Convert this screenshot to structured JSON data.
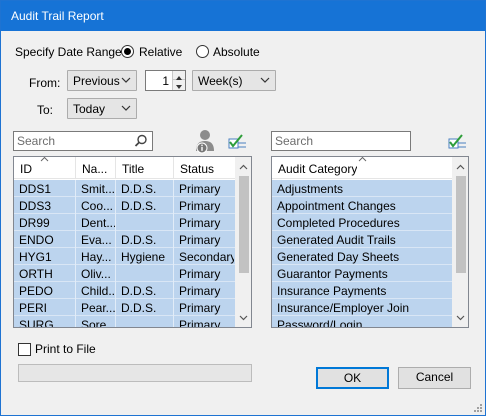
{
  "window": {
    "title": "Audit Trail Report"
  },
  "date_range": {
    "label": "Specify Date Range",
    "mode_options": [
      "Relative",
      "Absolute"
    ],
    "selected_mode": "Relative"
  },
  "from": {
    "label": "From:",
    "direction": "Previous",
    "amount": "1",
    "unit": "Week(s)"
  },
  "to": {
    "label": "To:",
    "value": "Today"
  },
  "providers": {
    "search_placeholder": "Search",
    "columns": [
      "ID",
      "Na...",
      "Title",
      "Status"
    ],
    "sorted_column": "ID",
    "rows": [
      [
        "DDS1",
        "Smit...",
        "D.D.S.",
        "Primary"
      ],
      [
        "DDS3",
        "Coo...",
        "D.D.S.",
        "Primary"
      ],
      [
        "DR99",
        "Dent...",
        "",
        "Primary"
      ],
      [
        "ENDO",
        "Eva...",
        "D.D.S.",
        "Primary"
      ],
      [
        "HYG1",
        "Hay...",
        "Hygiene",
        "Secondary"
      ],
      [
        "ORTH",
        "Oliv...",
        "",
        "Primary"
      ],
      [
        "PEDO",
        "Child...",
        "D.D.S.",
        "Primary"
      ],
      [
        "PERI",
        "Pear...",
        "D.D.S.",
        "Primary"
      ],
      [
        "SURG",
        "Sore...",
        "",
        "Primary"
      ]
    ]
  },
  "categories": {
    "search_placeholder": "Search",
    "column": "Audit Category",
    "rows": [
      "Adjustments",
      "Appointment Changes",
      "Completed Procedures",
      "Generated Audit Trails",
      "Generated Day Sheets",
      "Guarantor Payments",
      "Insurance Payments",
      "Insurance/Employer Join",
      "Password/Login"
    ]
  },
  "print_to_file": {
    "label": "Print to File",
    "checked": false
  },
  "buttons": {
    "ok": "OK",
    "cancel": "Cancel"
  },
  "colors": {
    "title_bar": "#1673d6",
    "selection": "#bcd4ee",
    "dialog_bg": "#f0f0f0",
    "checklist_icon_green": "#2e9e3a",
    "default_button_border": "#0078d7"
  }
}
